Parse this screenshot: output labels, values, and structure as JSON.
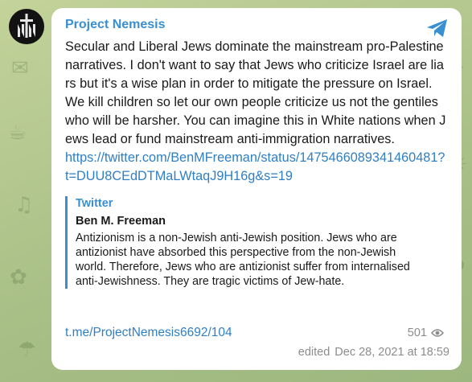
{
  "channel": {
    "name": "Project Nemesis",
    "avatar_icon": "nemesis-sword-logo"
  },
  "message": {
    "text": "Secular and Liberal Jews dominate the mainstream pro-Palestine narratives. I don't want to say that Jews who criticize Israel are liars but it's a wise plan in order to mitigate the pressure on Israel. We kill children so let our own people criticize us not the gentiles who will be harsher. You can imagine this in White nations when Jews lead or fund mainstream anti-immigration narratives.",
    "link": "https://twitter.com/BenMFreeman/status/1475466089341460481?t=DUU8CEdDTMaLWtaqJ9H16g&s=19"
  },
  "preview": {
    "site": "Twitter",
    "title": "Ben M. Freeman",
    "description": "Antizionism is a non-Jewish anti-Jewish position. Jews who are antizionist have absorbed this perspective from the non-Jewish world. Therefore, Jews who are antizionist suffer from internalised anti-Jewishness. They are tragic victims of Jew-hate."
  },
  "footer": {
    "post_link": "t.me/ProjectNemesis6692/104",
    "views": "501",
    "views_icon": "eye-icon",
    "edited_label": "edited",
    "timestamp": "Dec 28, 2021 at 18:59"
  },
  "colors": {
    "accent": "#3a8fd1",
    "link": "#2f7fc4",
    "muted": "#8c8c8c",
    "background": "#b5c98f"
  }
}
